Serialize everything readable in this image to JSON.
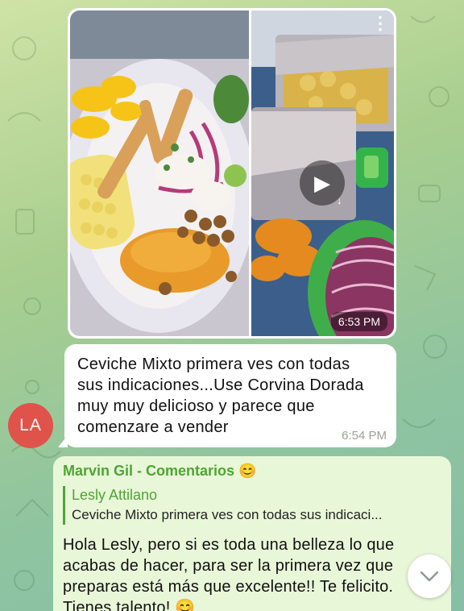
{
  "colors": {
    "accent_green": "#4ea532",
    "avatar_bg": "#e0534a",
    "bubble_white": "#ffffff",
    "bubble_green": "#e9f7d9"
  },
  "album": {
    "time": "6:53 PM",
    "icons": {
      "play": "play-icon",
      "download": "download-icon",
      "more": "more-vertical-icon"
    }
  },
  "caption": {
    "text": "Ceviche Mixto primera ves con todas\nsus indicaciones...Use Corvina Dorada\nmuy muy delicioso y parece que\ncomenzare a vender",
    "time": "6:54 PM"
  },
  "avatar": {
    "initials": "LA"
  },
  "comment": {
    "author": "Marvin Gil - Comentarios 😊",
    "reply_name": "Lesly Attilano",
    "reply_text": "Ceviche Mixto primera ves con todas sus indicaci...",
    "body": "Hola Lesly, pero si es toda una belleza lo que\nacabas de hacer, para ser la primera vez que\npreparas está más que excelente!! Te felicito.\nTienes talento! 😊"
  },
  "scroll_button": {
    "icon": "chevron-down-icon"
  }
}
